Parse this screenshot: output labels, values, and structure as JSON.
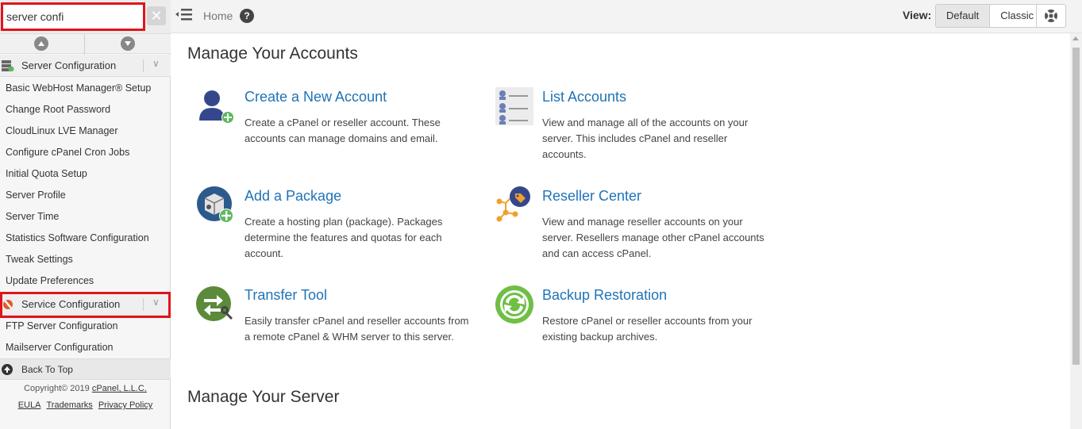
{
  "search": {
    "value": "server confi",
    "clear_icon": "close-icon"
  },
  "sidebar": {
    "sections": [
      {
        "label": "Server Configuration",
        "icon": "server-config-icon",
        "items": [
          "Basic WebHost Manager® Setup",
          "Change Root Password",
          "CloudLinux LVE Manager",
          "Configure cPanel Cron Jobs",
          "Initial Quota Setup",
          "Server Profile",
          "Server Time",
          "Statistics Software Configuration",
          "Tweak Settings",
          "Update Preferences"
        ]
      },
      {
        "label": "Service Configuration",
        "icon": "wrench-gear-icon",
        "items": [
          "FTP Server Configuration",
          "Mailserver Configuration"
        ]
      }
    ],
    "back_to_top": "Back To Top",
    "copyright_prefix": "Copyright© 2019 ",
    "copyright_link": "cPanel, L.L.C.",
    "footer_links": [
      "EULA",
      "Trademarks",
      "Privacy Policy"
    ]
  },
  "topbar": {
    "home": "Home",
    "view_label": "View:",
    "view_options": [
      "Default",
      "Classic"
    ],
    "view_selected": "Default"
  },
  "main": {
    "sections": [
      {
        "title": "Manage Your Accounts",
        "cards": [
          {
            "icon": "user-add-icon",
            "title": "Create a New Account",
            "desc": "Create a cPanel or reseller account. These accounts can manage domains and email."
          },
          {
            "icon": "list-accounts-icon",
            "title": "List Accounts",
            "desc": "View and manage all of the accounts on your server. This includes cPanel and reseller accounts."
          },
          {
            "icon": "package-add-icon",
            "title": "Add a Package",
            "desc": "Create a hosting plan (package). Packages determine the features and quotas for each account."
          },
          {
            "icon": "reseller-network-icon",
            "title": "Reseller Center",
            "desc": "View and manage reseller accounts on your server. Resellers manage other cPanel accounts and can access cPanel."
          },
          {
            "icon": "transfer-tool-icon",
            "title": "Transfer Tool",
            "desc": "Easily transfer cPanel and reseller accounts from a remote cPanel & WHM server to this server."
          },
          {
            "icon": "backup-restore-icon",
            "title": "Backup Restoration",
            "desc": "Restore cPanel or reseller accounts from your existing backup archives."
          }
        ]
      },
      {
        "title": "Manage Your Server",
        "cards": []
      }
    ]
  },
  "colors": {
    "accent": "#1f73b7",
    "highlight": "#e0141c",
    "green": "#5cb85c"
  }
}
